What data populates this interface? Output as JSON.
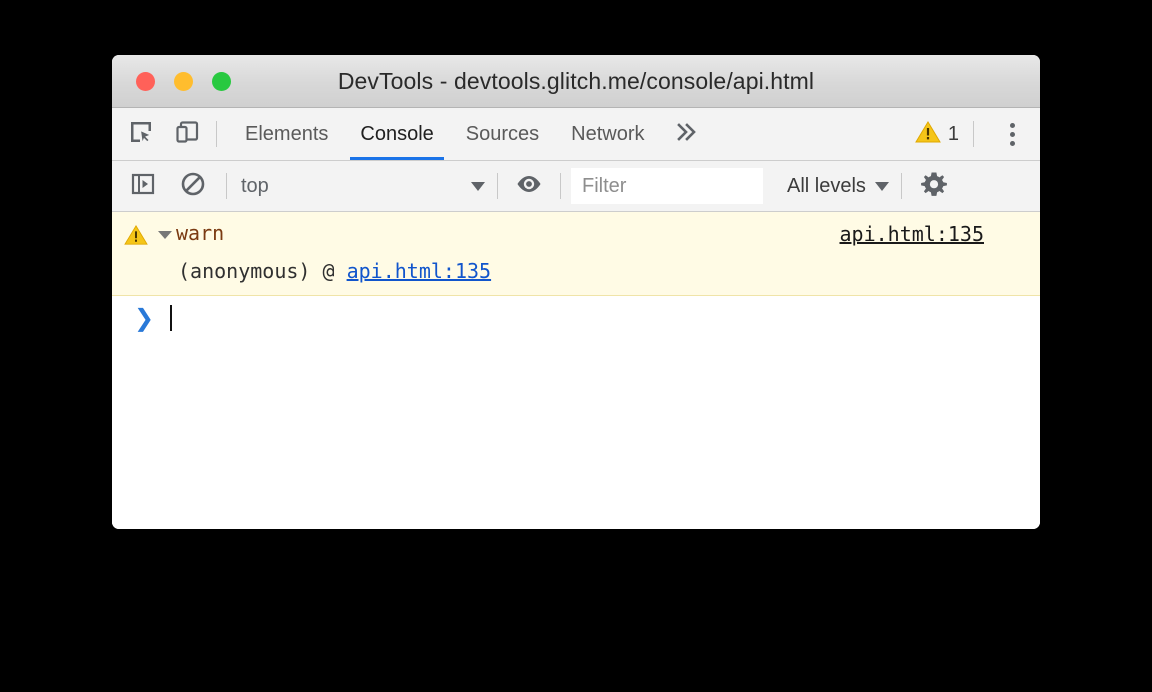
{
  "window": {
    "title": "DevTools - devtools.glitch.me/console/api.html",
    "traffic_lights": [
      {
        "name": "close",
        "color": "#ff6159"
      },
      {
        "name": "minimize",
        "color": "#ffbd2e"
      },
      {
        "name": "maximize",
        "color": "#28c940"
      }
    ]
  },
  "tabbar": {
    "icons": [
      {
        "name": "inspect-element-icon",
        "title": "Inspect element"
      },
      {
        "name": "device-toolbar-icon",
        "title": "Toggle device toolbar"
      }
    ],
    "tabs": [
      {
        "label": "Elements",
        "active": false
      },
      {
        "label": "Console",
        "active": true
      },
      {
        "label": "Sources",
        "active": false
      },
      {
        "label": "Network",
        "active": false
      }
    ],
    "more_tabs_label": "»",
    "warning_count": "1",
    "kebab_label": "Customize and control DevTools",
    "accent_color": "#1a73e8",
    "warning_color": "#f5c518"
  },
  "console_toolbar": {
    "sidebar_toggle": "Show console sidebar",
    "clear_console": "Clear console",
    "context": {
      "value": "top",
      "options": [
        "top"
      ]
    },
    "eye_button": "Create live expression",
    "filter": {
      "value": "",
      "placeholder": "Filter"
    },
    "levels": {
      "value": "All levels",
      "options": [
        "All levels"
      ]
    },
    "settings": "Console settings"
  },
  "console": {
    "messages": [
      {
        "level": "warning",
        "expanded": true,
        "text": "warn",
        "source": "api.html:135",
        "stack": [
          {
            "fn": "(anonymous) @ ",
            "link": "api.html:135"
          }
        ]
      }
    ],
    "prompt": {
      "chevron": "❯",
      "value": ""
    },
    "colors": {
      "warning_background": "#fffbe5",
      "warning_border": "#f0e4a8",
      "warning_text": "#7a3a12",
      "link": "#1155cc",
      "prompt_chevron": "#2979d8"
    }
  }
}
